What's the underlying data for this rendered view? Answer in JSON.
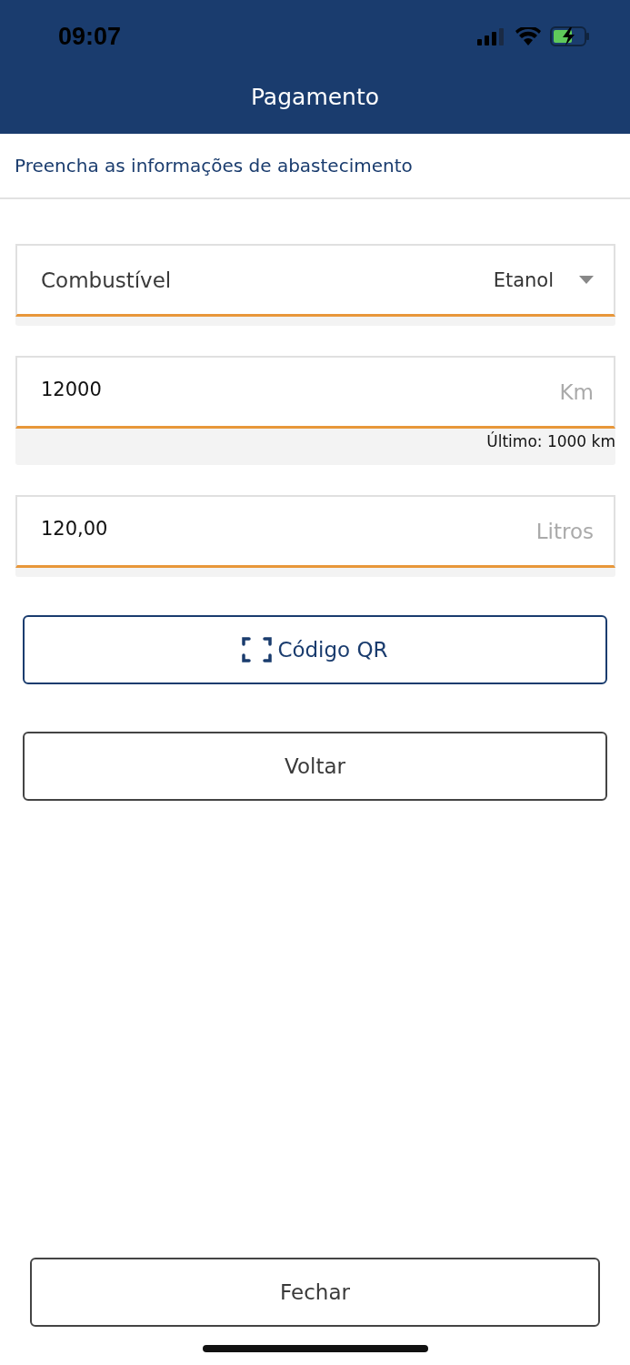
{
  "status_bar": {
    "time": "09:07"
  },
  "header": {
    "title": "Pagamento"
  },
  "subtitle": "Preencha as informações de abastecimento",
  "fields": [
    {
      "kind": "select",
      "label": "Combustível",
      "value": "Etanol"
    },
    {
      "kind": "input",
      "value": "12000",
      "unit": "Km",
      "hint": "Último: 1000 km"
    },
    {
      "kind": "input",
      "value": "120,00",
      "unit": "Litros"
    }
  ],
  "actions": [
    {
      "kind": "qr",
      "label": "Código QR"
    },
    {
      "kind": "plain",
      "label": "Voltar"
    }
  ],
  "footer_button": "Fechar"
}
